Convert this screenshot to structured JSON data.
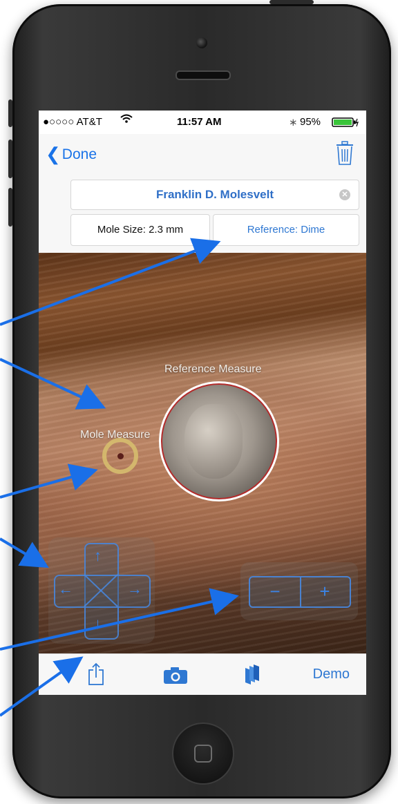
{
  "status_bar": {
    "carrier": "●○○○○ AT&T",
    "time": "11:57 AM",
    "battery": "95%"
  },
  "nav": {
    "back_label": "Done",
    "delete_icon": "trash-icon"
  },
  "form": {
    "patient_name": "Franklin D. Molesvelt",
    "mole_size": "Mole Size: 2.3 mm",
    "reference": "Reference: Dime"
  },
  "photo": {
    "reference_label": "Reference Measure",
    "mole_label": "Mole Measure"
  },
  "controls": {
    "directional_pad_icons": [
      "arrow-up-icon",
      "arrow-down-icon",
      "arrow-left-icon",
      "arrow-right-icon"
    ],
    "zoom_minus": "−",
    "zoom_plus": "+"
  },
  "toolbar": {
    "share_icon": "share-icon",
    "camera_icon": "camera-icon",
    "gallery_icon": "gallery-icon",
    "demo_label": "Demo"
  },
  "colors": {
    "accent": "#2f78d2",
    "callout": "#1a6fe8"
  }
}
